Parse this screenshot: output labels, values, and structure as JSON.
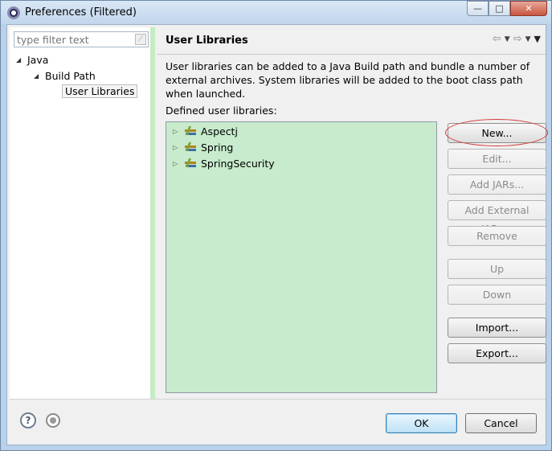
{
  "window": {
    "title": "Preferences (Filtered)",
    "min_glyph": "—",
    "max_glyph": "□",
    "close_glyph": "✕"
  },
  "filter": {
    "placeholder": "type filter text",
    "value": ""
  },
  "tree": {
    "items": [
      {
        "label": "Java",
        "level": 0,
        "expanded": true
      },
      {
        "label": "Build Path",
        "level": 1,
        "expanded": true
      },
      {
        "label": "User Libraries",
        "level": 2,
        "selected": true
      }
    ]
  },
  "page": {
    "title": "User Libraries",
    "description": "User libraries can be added to a Java Build path and bundle a number of external archives. System libraries will be added to the boot class path when launched.",
    "defined_label": "Defined user libraries:"
  },
  "libraries": [
    {
      "name": "Aspectj"
    },
    {
      "name": "Spring"
    },
    {
      "name": "SpringSecurity"
    }
  ],
  "buttons": {
    "new": "New...",
    "edit": "Edit...",
    "add_jars": "Add JARs...",
    "add_external_jars": "Add External JARs...",
    "remove": "Remove",
    "up": "Up",
    "down": "Down",
    "import": "Import...",
    "export": "Export...",
    "ok": "OK",
    "cancel": "Cancel"
  },
  "icons": {
    "back": "arrow-left-icon",
    "forward": "arrow-right-icon",
    "menu": "view-menu-icon",
    "help": "help-icon",
    "record": "record-icon"
  },
  "colors": {
    "list_background": "#c7ebcc",
    "highlight_ring": "#d43a3a"
  }
}
